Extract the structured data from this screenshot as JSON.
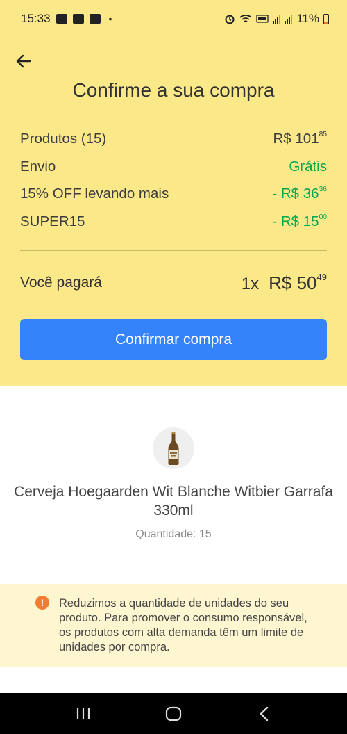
{
  "status_bar": {
    "time": "15:33",
    "battery": "11%",
    "dot": "•"
  },
  "header": {
    "title": "Confirme a sua compra"
  },
  "summary": {
    "rows": [
      {
        "label": "Produtos (15)",
        "value_main": "R$ 101",
        "value_cents": "85",
        "color": "default"
      },
      {
        "label": "Envio",
        "value_main": "Grátis",
        "value_cents": "",
        "color": "#00a650"
      },
      {
        "label": "15% OFF levando mais",
        "value_main": "- R$ 36",
        "value_cents": "36",
        "color": "#00a650"
      },
      {
        "label": "SUPER15",
        "value_main": "- R$ 15",
        "value_cents": "00",
        "color": "#00a650"
      }
    ],
    "total": {
      "label": "Você pagará",
      "quantity": "1x",
      "value_main": "R$ 50",
      "value_cents": "49"
    },
    "confirm_button": "Confirmar compra"
  },
  "product": {
    "name": "Cerveja Hoegaarden Wit Blanche Witbier Garrafa 330ml",
    "quantity": "Quantidade: 15"
  },
  "notice": {
    "icon": "!",
    "text": "Reduzimos a quantidade de unidades do seu produto. Para promover o consumo responsável, os produtos com alta demanda têm um limite de unidades por compra."
  },
  "colors": {
    "accent_yellow": "#fbe889",
    "primary_blue": "#3483fa",
    "discount_green": "#00a650",
    "warning_orange": "#f27d32"
  }
}
